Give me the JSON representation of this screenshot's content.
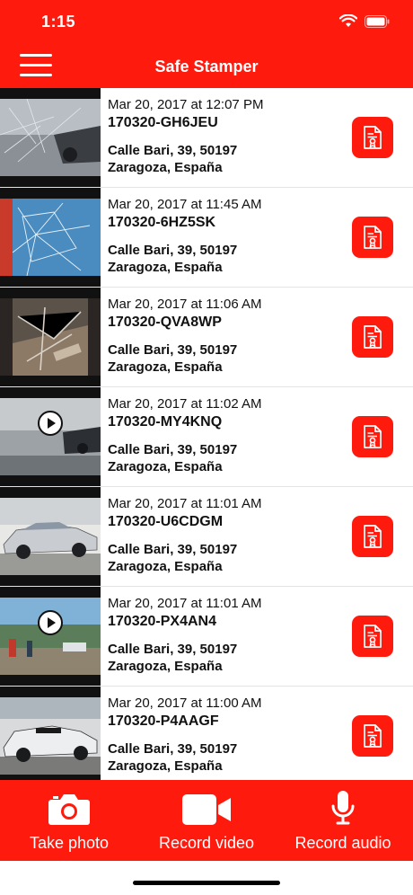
{
  "status_bar": {
    "time": "1:15"
  },
  "header": {
    "title": "Safe Stamper"
  },
  "items": [
    {
      "date": "Mar 20, 2017 at 12:07 PM",
      "code": "170320-GH6JEU",
      "address_line1": "Calle Bari, 39, 50197",
      "address_line2": "Zaragoza, España",
      "media": "photo"
    },
    {
      "date": "Mar 20, 2017 at 11:45 AM",
      "code": "170320-6HZ5SK",
      "address_line1": "Calle Bari, 39, 50197",
      "address_line2": "Zaragoza, España",
      "media": "photo"
    },
    {
      "date": "Mar 20, 2017 at 11:06 AM",
      "code": "170320-QVA8WP",
      "address_line1": "Calle Bari, 39, 50197",
      "address_line2": "Zaragoza, España",
      "media": "photo"
    },
    {
      "date": "Mar 20, 2017 at 11:02 AM",
      "code": "170320-MY4KNQ",
      "address_line1": "Calle Bari, 39, 50197",
      "address_line2": "Zaragoza, España",
      "media": "video"
    },
    {
      "date": "Mar 20, 2017 at 11:01 AM",
      "code": "170320-U6CDGM",
      "address_line1": "Calle Bari, 39, 50197",
      "address_line2": "Zaragoza, España",
      "media": "photo"
    },
    {
      "date": "Mar 20, 2017 at 11:01 AM",
      "code": "170320-PX4AN4",
      "address_line1": "Calle Bari, 39, 50197",
      "address_line2": "Zaragoza, España",
      "media": "video"
    },
    {
      "date": "Mar 20, 2017 at 11:00 AM",
      "code": "170320-P4AAGF",
      "address_line1": "Calle Bari, 39, 50197",
      "address_line2": "Zaragoza, España",
      "media": "photo"
    }
  ],
  "tab_bar": {
    "take_photo": "Take photo",
    "record_video": "Record video",
    "record_audio": "Record audio"
  },
  "colors": {
    "accent": "#ff1a0e",
    "text": "#111111",
    "divider": "#e4e4e4"
  },
  "icons": {
    "menu": "hamburger-menu-icon",
    "document": "certificate-document-icon",
    "camera": "camera-icon",
    "video": "video-camera-icon",
    "audio": "microphone-icon"
  }
}
